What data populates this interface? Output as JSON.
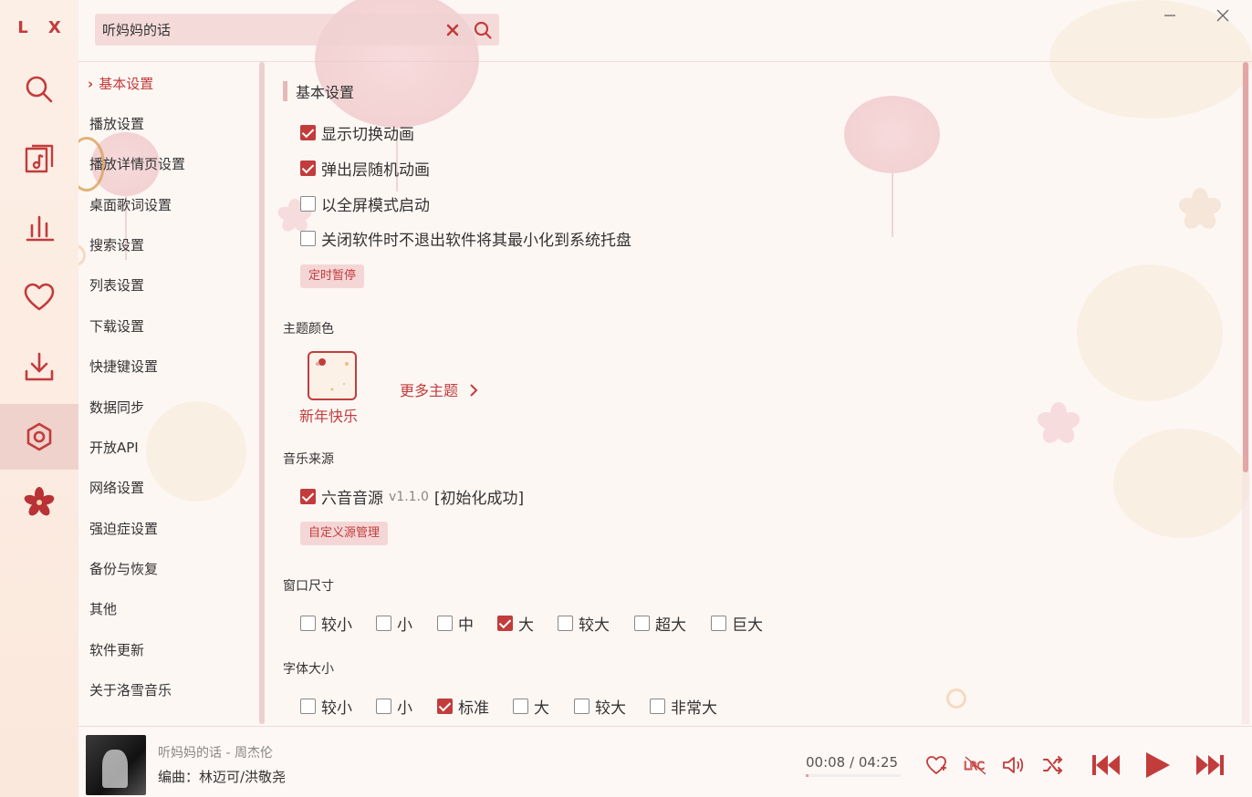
{
  "app": {
    "logo": "L X"
  },
  "search": {
    "value": "听妈妈的话"
  },
  "nav": {
    "items": [
      "基本设置",
      "播放设置",
      "播放详情页设置",
      "桌面歌词设置",
      "搜索设置",
      "列表设置",
      "下载设置",
      "快捷键设置",
      "数据同步",
      "开放API",
      "网络设置",
      "强迫症设置",
      "备份与恢复",
      "其他",
      "软件更新",
      "关于洛雪音乐"
    ],
    "active_index": 0
  },
  "basic": {
    "title": "基本设置",
    "options": [
      {
        "label": "显示切换动画",
        "checked": true
      },
      {
        "label": "弹出层随机动画",
        "checked": true
      },
      {
        "label": "以全屏模式启动",
        "checked": false
      },
      {
        "label": "关闭软件时不退出软件将其最小化到系统托盘",
        "checked": false
      }
    ],
    "timer_button": "定时暂停"
  },
  "theme": {
    "label": "主题颜色",
    "current": "新年快乐",
    "more": "更多主题"
  },
  "source": {
    "label": "音乐来源",
    "name": "六音音源",
    "version": "v1.1.0",
    "status": "[初始化成功]",
    "checked": true,
    "manage_button": "自定义源管理"
  },
  "window_size": {
    "label": "窗口尺寸",
    "options": [
      {
        "label": "较小",
        "checked": false
      },
      {
        "label": "小",
        "checked": false
      },
      {
        "label": "中",
        "checked": false
      },
      {
        "label": "大",
        "checked": true
      },
      {
        "label": "较大",
        "checked": false
      },
      {
        "label": "超大",
        "checked": false
      },
      {
        "label": "巨大",
        "checked": false
      }
    ]
  },
  "font_size": {
    "label": "字体大小",
    "options": [
      {
        "label": "较小",
        "checked": false
      },
      {
        "label": "小",
        "checked": false
      },
      {
        "label": "标准",
        "checked": true
      },
      {
        "label": "大",
        "checked": false
      },
      {
        "label": "较大",
        "checked": false
      },
      {
        "label": "非常大",
        "checked": false
      }
    ]
  },
  "player": {
    "title": "听妈妈的话 - 周杰伦",
    "subtitle": "编曲：林迈可/洪敬尧",
    "time": "00:08 / 04:25",
    "progress": 0.03,
    "lyric_button": "LRC"
  },
  "colors": {
    "accent": "#c23c3c",
    "soft": "#f5d6d6"
  },
  "icons": {
    "rail": [
      "search-icon",
      "music-note-icon",
      "chart-icon",
      "heart-icon",
      "download-icon",
      "settings-icon",
      "flower-icon"
    ],
    "player": [
      "heart-icon",
      "lyric-icon",
      "volume-icon",
      "shuffle-icon",
      "prev-icon",
      "play-icon",
      "next-icon"
    ]
  }
}
